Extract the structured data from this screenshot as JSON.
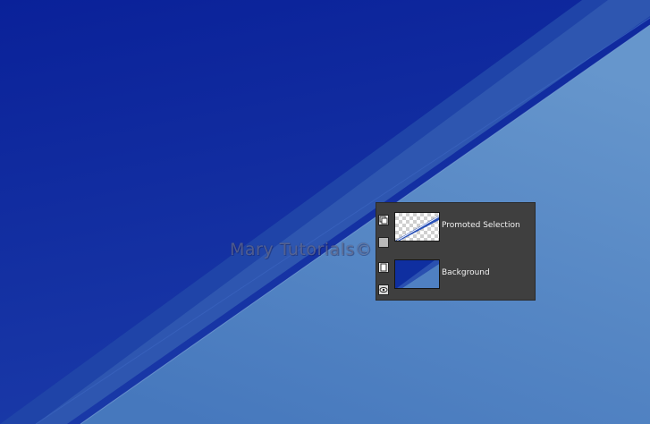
{
  "canvas": {
    "colors": {
      "dark_blue_top": "#0a2199",
      "dark_blue_bottom": "#1a3aa8",
      "band_blue": "#2e56b0",
      "light_blue": "#5a8bc6",
      "light_blue_bottom": "#4678bd"
    }
  },
  "watermark": {
    "text": "Mary Tutorials©"
  },
  "layers_panel": {
    "colors": {
      "background": "#3f3f3f",
      "text": "#f2f2f2"
    },
    "layers": [
      {
        "name": "Promoted Selection",
        "thumbnail": "checkerboard-with-blue-diagonal-stripe",
        "top_control_icon": "layer-group-icon",
        "bottom_control_icon": "gray-square-icon"
      },
      {
        "name": "Background",
        "thumbnail": "blue-gradient-with-diagonal",
        "top_control_icon": "layer-page-icon",
        "bottom_control_icon": "eye-icon"
      }
    ]
  }
}
